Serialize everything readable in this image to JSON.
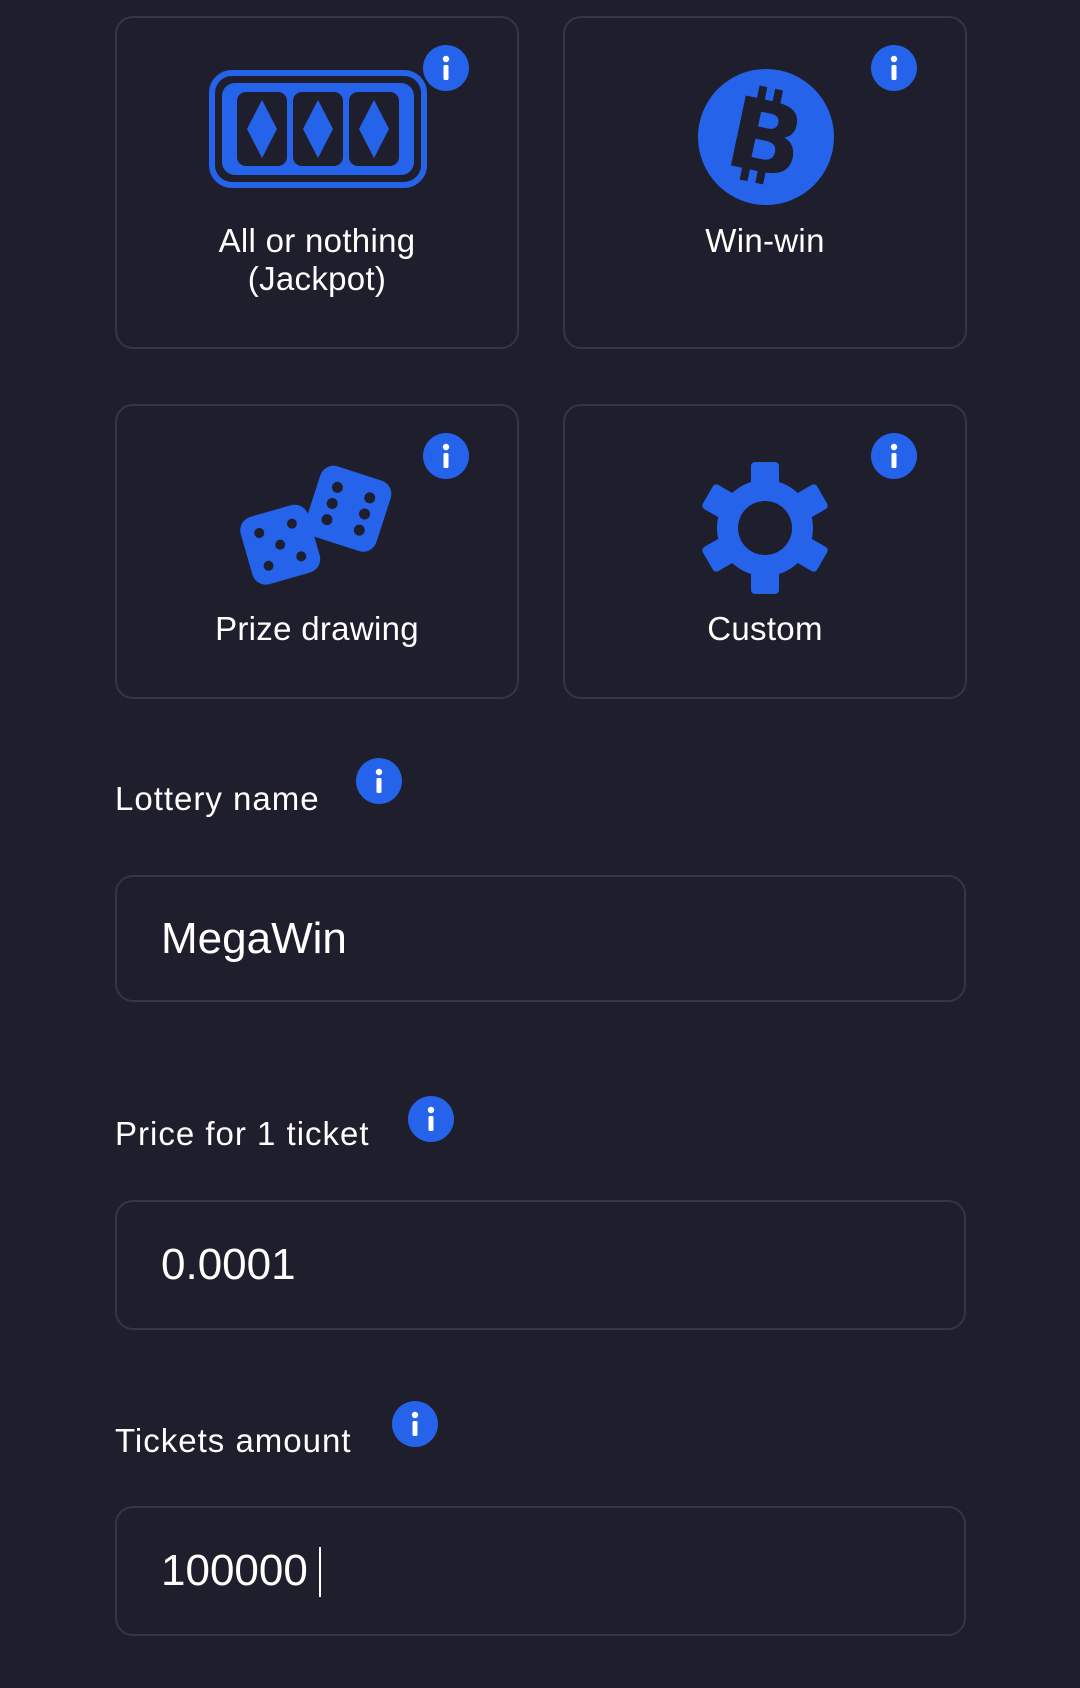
{
  "colors": {
    "background": "#1e1e2c",
    "border": "#353545",
    "accent": "#2563eb",
    "text": "#ffffff"
  },
  "lottery_types": [
    {
      "label": "All or nothing\n(Jackpot)",
      "icon": "slot-machine-icon"
    },
    {
      "label": "Win-win",
      "icon": "bitcoin-icon"
    },
    {
      "label": "Prize drawing",
      "icon": "dice-icon"
    },
    {
      "label": "Custom",
      "icon": "gear-icon"
    }
  ],
  "fields": {
    "lottery_name": {
      "label": "Lottery name",
      "value": "MegaWin"
    },
    "ticket_price": {
      "label": "Price for 1 ticket",
      "value": "0.0001"
    },
    "tickets_amount": {
      "label": "Tickets amount",
      "value": "100000"
    }
  }
}
